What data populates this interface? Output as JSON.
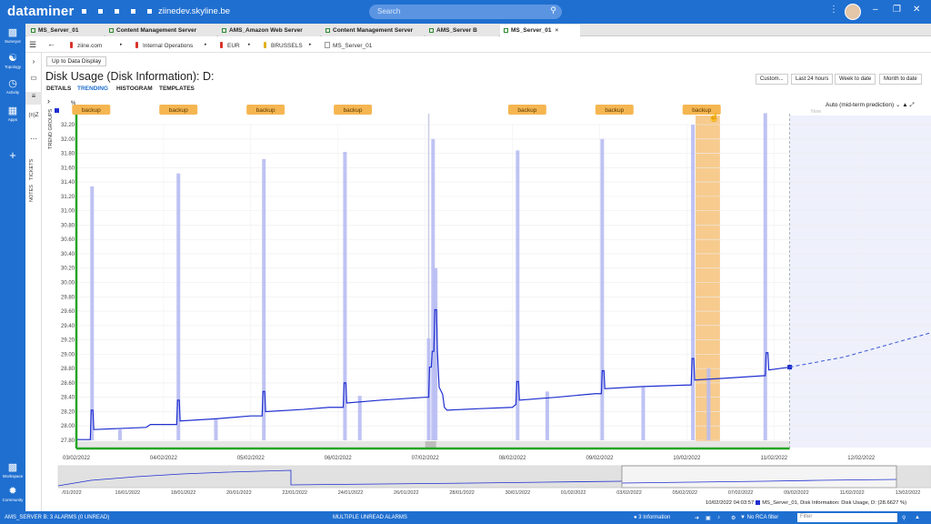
{
  "app": {
    "brand": "dataminer",
    "hostname": "ziinedev.skyline.be",
    "search_placeholder": "Search"
  },
  "left_rail": [
    {
      "label": "Surveyor",
      "icon": "surveyor-icon"
    },
    {
      "label": "Topology",
      "icon": "topology-icon"
    },
    {
      "label": "Activity",
      "icon": "activity-icon"
    },
    {
      "label": "Apps",
      "icon": "apps-icon"
    },
    {
      "label": "Workspace",
      "icon": "workspace-icon"
    },
    {
      "label": "Community",
      "icon": "community-icon"
    }
  ],
  "tabs": [
    {
      "label": "MS_Server_01",
      "active": false
    },
    {
      "label": "Content Management Server",
      "active": false
    },
    {
      "label": "AMS_Amazon Web Server",
      "active": false
    },
    {
      "label": "Content Management Server",
      "active": false
    },
    {
      "label": "AMS_Server B",
      "active": false
    },
    {
      "label": "MS_Server_01",
      "active": true
    }
  ],
  "breadcrumbs": [
    {
      "label": "ziine.com",
      "color": "#d9342b"
    },
    {
      "label": "Internal Operations",
      "color": "#d9342b"
    },
    {
      "label": "EUR",
      "color": "#d9342b"
    },
    {
      "label": "BRUSSELS",
      "color": "#e0b020"
    },
    {
      "label": "MS_Server_01",
      "color": "none"
    }
  ],
  "side_labels": {
    "tickets": "TICKETS",
    "notes": "NOTES",
    "trend_groups": "TREND GROUPS",
    "indicator": "(n)Z"
  },
  "page": {
    "up_button": "Up to Data Display",
    "title": "Disk Usage (Disk Information): D:",
    "subtabs": [
      {
        "label": "DETAILS",
        "active": false
      },
      {
        "label": "TRENDING",
        "active": true
      },
      {
        "label": "HISTOGRAM",
        "active": false
      },
      {
        "label": "TEMPLATES",
        "active": false
      }
    ],
    "range_buttons": [
      "Custom...",
      "Last 24 hours",
      "Week to date",
      "Month to date"
    ],
    "prediction_mode": "Auto (mid-term prediction)",
    "now_label": "Now"
  },
  "chart_data": {
    "type": "line",
    "unit": "%",
    "ylim": [
      27.8,
      32.2
    ],
    "yticks": [
      "27.80",
      "28.00",
      "28.20",
      "28.40",
      "28.60",
      "28.80",
      "29.00",
      "29.20",
      "29.40",
      "29.60",
      "29.80",
      "30.00",
      "30.20",
      "30.40",
      "30.60",
      "30.80",
      "31.00",
      "31.20",
      "31.40",
      "31.60",
      "31.80",
      "32.00",
      "32.20"
    ],
    "xlim": [
      0,
      9.8
    ],
    "x_labels": [
      {
        "x": 0,
        "label": "03/02/2022"
      },
      {
        "x": 1,
        "label": "04/02/2022"
      },
      {
        "x": 2,
        "label": "05/02/2022"
      },
      {
        "x": 3,
        "label": "06/02/2022"
      },
      {
        "x": 4,
        "label": "07/02/2022"
      },
      {
        "x": 5,
        "label": "08/02/2022"
      },
      {
        "x": 6,
        "label": "09/02/2022"
      },
      {
        "x": 7,
        "label": "10/02/2022"
      },
      {
        "x": 8,
        "label": "11/02/2022"
      },
      {
        "x": 9,
        "label": "12/02/2022"
      }
    ],
    "now_x": 8.18,
    "annotations": [
      {
        "x": 0.17,
        "label": "backup"
      },
      {
        "x": 1.17,
        "label": "backup"
      },
      {
        "x": 2.17,
        "label": "backup"
      },
      {
        "x": 3.17,
        "label": "backup"
      },
      {
        "x": 5.17,
        "label": "backup"
      },
      {
        "x": 6.17,
        "label": "backup"
      },
      {
        "x": 7.17,
        "label": "backup",
        "highlighted": true
      }
    ],
    "highlight_band": [
      7.1,
      7.38
    ],
    "series": [
      {
        "name": "Disk Usage, D:",
        "color": "#1f2fd0",
        "points": [
          [
            0,
            27.81
          ],
          [
            0.16,
            27.81
          ],
          [
            0.17,
            28.22
          ],
          [
            0.19,
            28.22
          ],
          [
            0.2,
            27.95
          ],
          [
            0.8,
            27.98
          ],
          [
            0.85,
            28.02
          ],
          [
            1.15,
            28.02
          ],
          [
            1.16,
            28.36
          ],
          [
            1.18,
            28.36
          ],
          [
            1.19,
            28.07
          ],
          [
            1.6,
            28.1
          ],
          [
            2.0,
            28.14
          ],
          [
            2.13,
            28.14
          ],
          [
            2.14,
            28.48
          ],
          [
            2.16,
            28.48
          ],
          [
            2.17,
            28.2
          ],
          [
            2.6,
            28.23
          ],
          [
            2.9,
            28.26
          ],
          [
            3.06,
            28.26
          ],
          [
            3.07,
            28.6
          ],
          [
            3.09,
            28.6
          ],
          [
            3.1,
            28.32
          ],
          [
            3.5,
            28.36
          ],
          [
            4.0,
            28.4
          ],
          [
            4.04,
            28.4
          ],
          [
            4.05,
            28.82
          ],
          [
            4.07,
            28.82
          ],
          [
            4.08,
            29.04
          ],
          [
            4.1,
            29.04
          ],
          [
            4.11,
            29.62
          ],
          [
            4.13,
            29.62
          ],
          [
            4.14,
            29.04
          ],
          [
            4.16,
            28.54
          ],
          [
            4.2,
            28.44
          ],
          [
            4.22,
            28.26
          ],
          [
            4.25,
            28.22
          ],
          [
            4.6,
            28.24
          ],
          [
            5.0,
            28.26
          ],
          [
            5.04,
            28.3
          ],
          [
            5.05,
            28.62
          ],
          [
            5.07,
            28.62
          ],
          [
            5.08,
            28.36
          ],
          [
            5.5,
            28.4
          ],
          [
            5.95,
            28.45
          ],
          [
            6.02,
            28.45
          ],
          [
            6.03,
            28.77
          ],
          [
            6.05,
            28.77
          ],
          [
            6.06,
            28.52
          ],
          [
            6.5,
            28.55
          ],
          [
            7.0,
            28.57
          ],
          [
            7.05,
            28.57
          ],
          [
            7.06,
            28.94
          ],
          [
            7.08,
            28.94
          ],
          [
            7.09,
            28.64
          ],
          [
            7.5,
            28.67
          ],
          [
            7.88,
            28.7
          ],
          [
            7.9,
            28.7
          ],
          [
            7.91,
            29.02
          ],
          [
            7.93,
            29.02
          ],
          [
            7.94,
            28.78
          ],
          [
            8.18,
            28.82
          ]
        ]
      },
      {
        "name": "Disk Usage, D: (max)",
        "color": "#b7bbf2",
        "bars": [
          [
            0.18,
            31.34
          ],
          [
            1.17,
            31.52
          ],
          [
            2.15,
            31.72
          ],
          [
            3.08,
            31.82
          ],
          [
            4.09,
            32.0
          ],
          [
            4.12,
            30.2
          ],
          [
            5.06,
            31.84
          ],
          [
            6.03,
            32.0
          ],
          [
            7.07,
            32.2
          ],
          [
            7.9,
            32.36
          ],
          [
            4.04,
            29.22
          ],
          [
            0.5,
            27.95
          ],
          [
            1.6,
            28.1
          ],
          [
            3.25,
            28.42
          ],
          [
            5.4,
            28.48
          ],
          [
            6.5,
            28.54
          ],
          [
            7.25,
            28.8
          ]
        ]
      },
      {
        "name": "Prediction",
        "color": "#3a55d6",
        "dashed": true,
        "points": [
          [
            8.18,
            28.82
          ],
          [
            8.8,
            28.96
          ],
          [
            9.8,
            29.3
          ]
        ]
      }
    ]
  },
  "overview": {
    "labels": [
      "/01/2022",
      "16/01/2022",
      "18/01/2022",
      "20/01/2022",
      "22/01/2022",
      "24/01/2022",
      "26/01/2022",
      "28/01/2022",
      "30/01/2022",
      "01/02/2022",
      "03/02/2022",
      "05/02/2022",
      "07/02/2022",
      "09/02/2022",
      "11/02/2022",
      "13/02/2022"
    ]
  },
  "readout": {
    "timestamp": "10/02/2022 04:03:57",
    "text": "MS_Server_01, Disk Information: Disk Usage, D: (28.6627 %)"
  },
  "statusbar": {
    "alarms": "AMS_SERVER B: 3 ALARMS (0 UNREAD)",
    "center": "MULTIPLE UNREAD ALARMS",
    "info": "3 Information",
    "rca": "No RCA filter",
    "filter_placeholder": "Filter"
  }
}
